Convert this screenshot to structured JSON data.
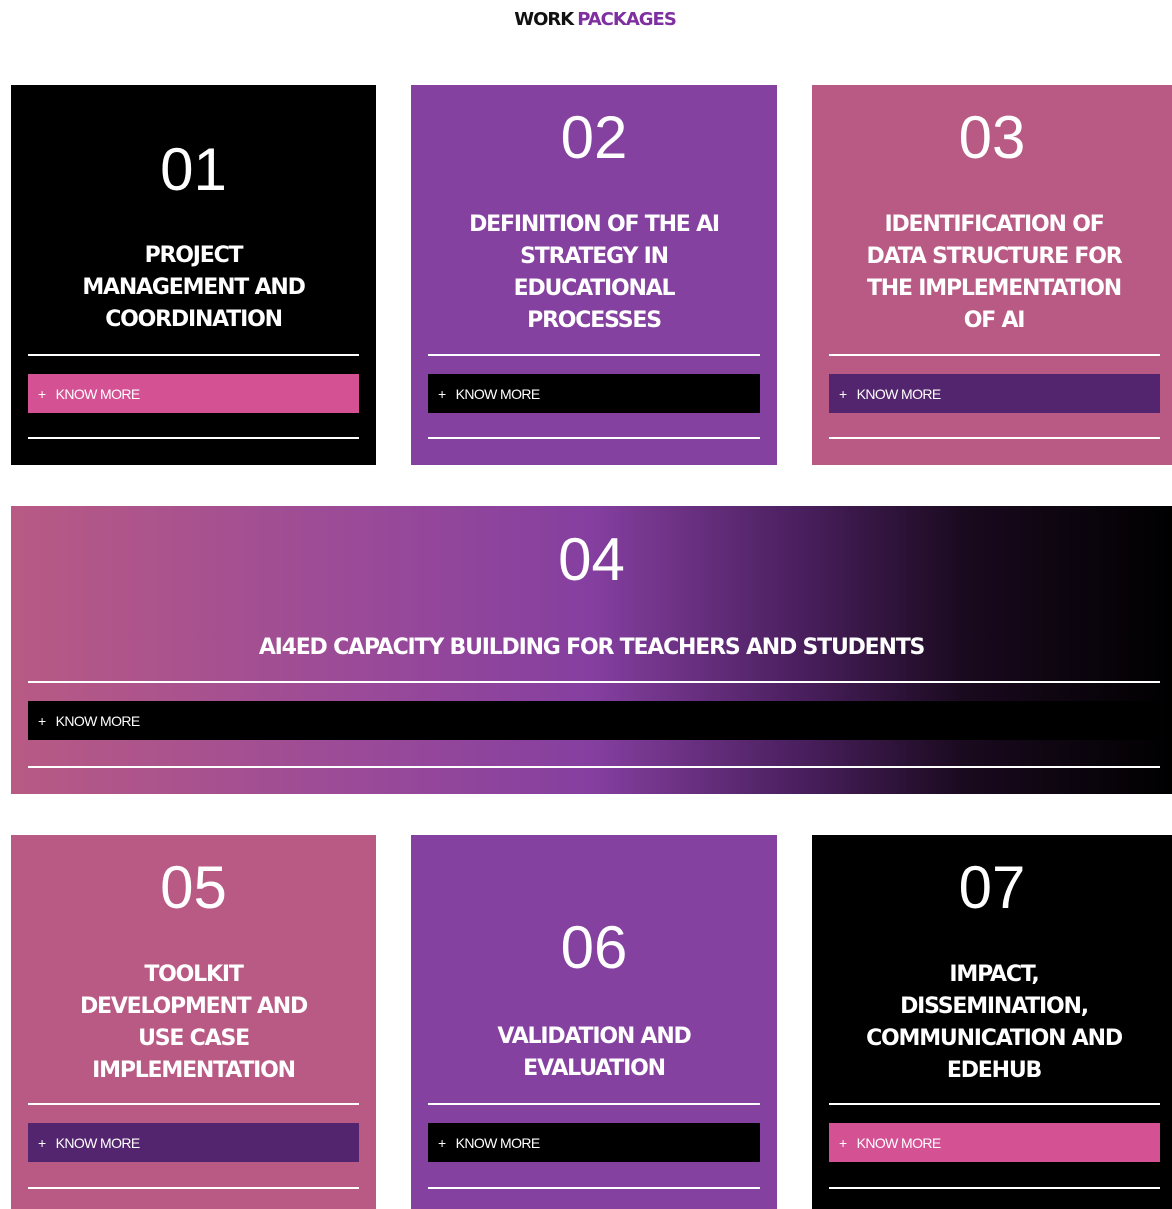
{
  "heading": {
    "part1": "WORK",
    "part2": "PACKAGES"
  },
  "colors": {
    "black": "#000000",
    "purple": "#8541a0",
    "rose": "#b85a84",
    "pink_button": "#d45294",
    "deep_purple_button": "#53256e"
  },
  "packages": [
    {
      "number": "01",
      "title_lines": [
        "PROJECT",
        "MANAGEMENT AND",
        "COORDINATION"
      ],
      "button": "KNOW MORE",
      "button_icon": "plus-icon"
    },
    {
      "number": "02",
      "title_lines": [
        "DEFINITION OF THE AI",
        "STRATEGY IN",
        "EDUCATIONAL",
        "PROCESSES"
      ],
      "button": "KNOW MORE",
      "button_icon": "plus-icon"
    },
    {
      "number": "03",
      "title_lines": [
        "IDENTIFICATION OF",
        "DATA STRUCTURE FOR",
        "THE IMPLEMENTATION",
        "OF AI"
      ],
      "button": "KNOW MORE",
      "button_icon": "plus-icon"
    },
    {
      "number": "04",
      "title_lines": [
        "AI4ED CAPACITY BUILDING FOR TEACHERS AND STUDENTS"
      ],
      "button": "KNOW MORE",
      "button_icon": "plus-icon"
    },
    {
      "number": "05",
      "title_lines": [
        "TOOLKIT",
        "DEVELOPMENT AND",
        "USE CASE",
        "IMPLEMENTATION"
      ],
      "button": "KNOW MORE",
      "button_icon": "plus-icon"
    },
    {
      "number": "06",
      "title_lines": [
        "VALIDATION AND",
        "EVALUATION"
      ],
      "button": "KNOW MORE",
      "button_icon": "plus-icon"
    },
    {
      "number": "07",
      "title_lines": [
        "IMPACT,",
        "DISSEMINATION,",
        "COMMUNICATION AND",
        "EDEHUB"
      ],
      "button": "KNOW MORE",
      "button_icon": "plus-icon"
    }
  ]
}
